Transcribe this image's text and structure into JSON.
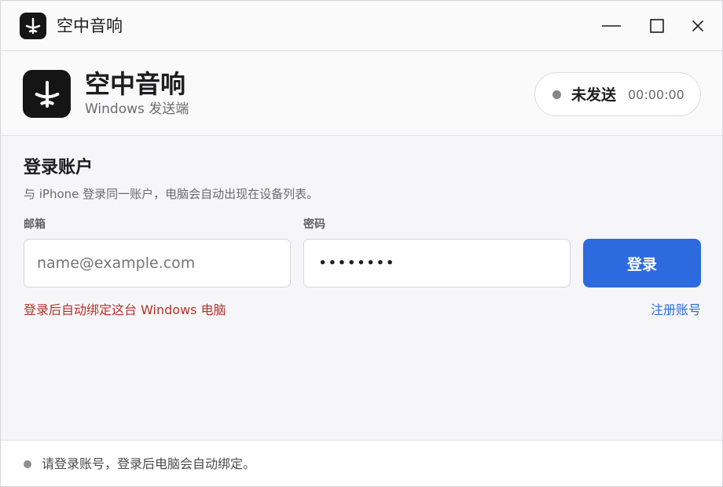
{
  "window": {
    "title": "空中音响",
    "icon": "airplane-icon",
    "controls": [
      "minimize-icon",
      "maximize-icon",
      "close-icon"
    ]
  },
  "header": {
    "app_name": "空中音响",
    "subtitle": "Windows 发送端",
    "status": {
      "label": "未发送",
      "time": "00:00:00",
      "dot_color": "#86868b"
    }
  },
  "login": {
    "title": "登录账户",
    "description": "与 iPhone 登录同一账户，电脑会自动出现在设备列表。",
    "email_label": "邮箱",
    "email_placeholder": "name@example.com",
    "email_value": "",
    "password_label": "密码",
    "password_masked": "••••••••",
    "submit_label": "登录",
    "hint": "登录后自动绑定这台 Windows 电脑",
    "register_link": "注册账号"
  },
  "footer": {
    "message": "请登录账号，登录后电脑会自动绑定。"
  },
  "colors": {
    "accent": "#2d6ae0",
    "warning": "#b4332a",
    "icon_bg": "#151515"
  }
}
